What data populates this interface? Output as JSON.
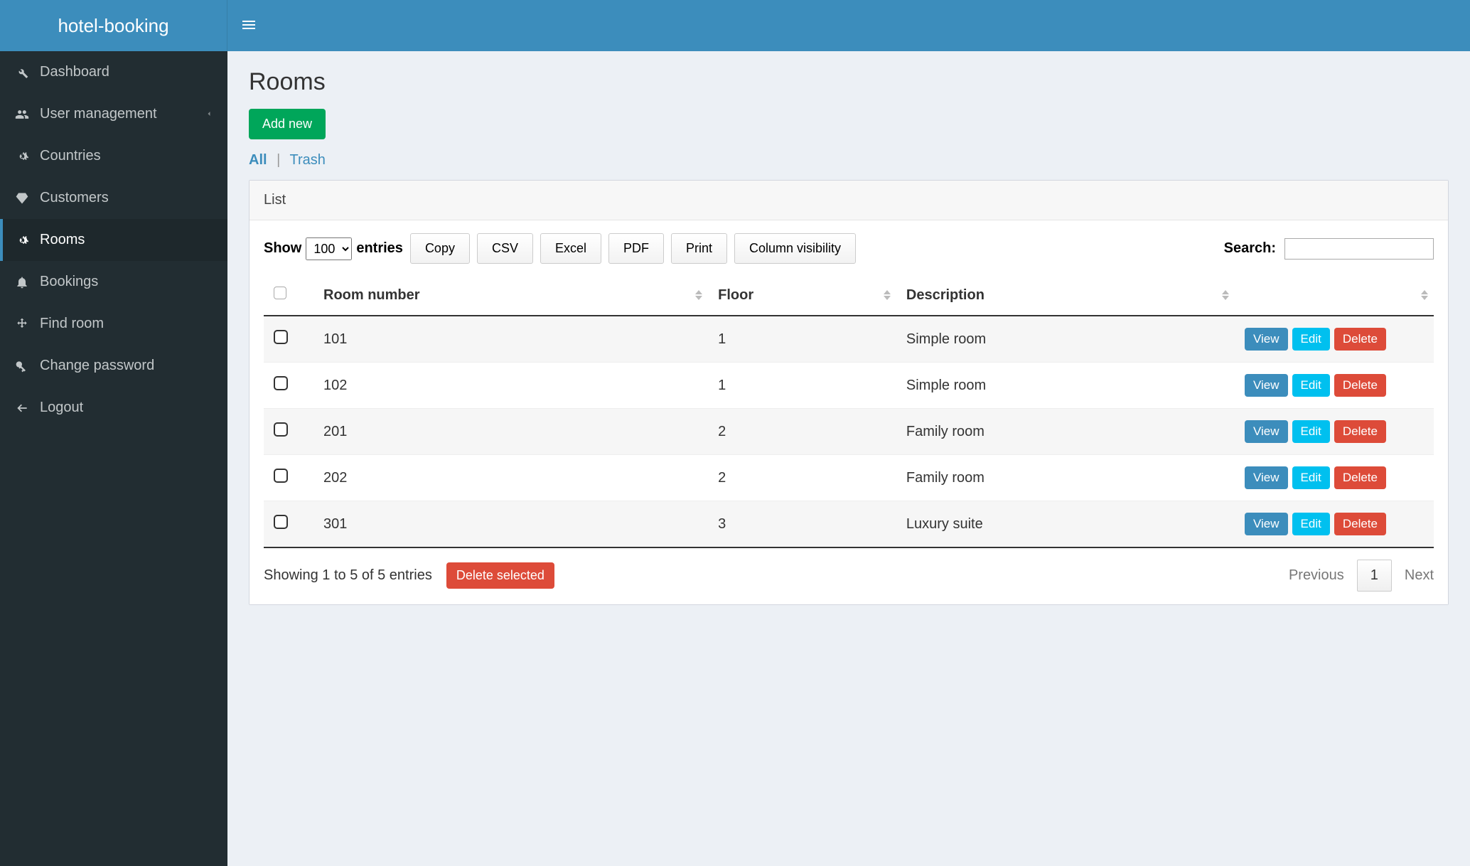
{
  "brand": "hotel-booking",
  "sidebar": {
    "items": [
      {
        "label": "Dashboard",
        "icon": "wrench"
      },
      {
        "label": "User management",
        "icon": "users",
        "has_children": true
      },
      {
        "label": "Countries",
        "icon": "cogs"
      },
      {
        "label": "Customers",
        "icon": "diamond"
      },
      {
        "label": "Rooms",
        "icon": "cogs",
        "active": true
      },
      {
        "label": "Bookings",
        "icon": "bell"
      },
      {
        "label": "Find room",
        "icon": "move"
      },
      {
        "label": "Change password",
        "icon": "key"
      },
      {
        "label": "Logout",
        "icon": "arrow-left"
      }
    ]
  },
  "page": {
    "title": "Rooms",
    "add_new": "Add new",
    "filters": {
      "all": "All",
      "trash": "Trash",
      "sep": "|"
    }
  },
  "panel": {
    "header": "List",
    "show_label_before": "Show",
    "show_label_after": "entries",
    "show_value": "100",
    "buttons": {
      "copy": "Copy",
      "csv": "CSV",
      "excel": "Excel",
      "pdf": "PDF",
      "print": "Print",
      "colvis": "Column visibility"
    },
    "search_label": "Search:",
    "search_value": ""
  },
  "table": {
    "headers": {
      "room_number": "Room number",
      "floor": "Floor",
      "description": "Description"
    },
    "rows": [
      {
        "room_number": "101",
        "floor": "1",
        "description": "Simple room"
      },
      {
        "room_number": "102",
        "floor": "1",
        "description": "Simple room"
      },
      {
        "room_number": "201",
        "floor": "2",
        "description": "Family room"
      },
      {
        "room_number": "202",
        "floor": "2",
        "description": "Family room"
      },
      {
        "room_number": "301",
        "floor": "3",
        "description": "Luxury suite"
      }
    ],
    "actions": {
      "view": "View",
      "edit": "Edit",
      "delete": "Delete"
    },
    "footer_info": "Showing 1 to 5 of 5 entries",
    "delete_selected": "Delete selected",
    "pagination": {
      "previous": "Previous",
      "page": "1",
      "next": "Next"
    }
  }
}
